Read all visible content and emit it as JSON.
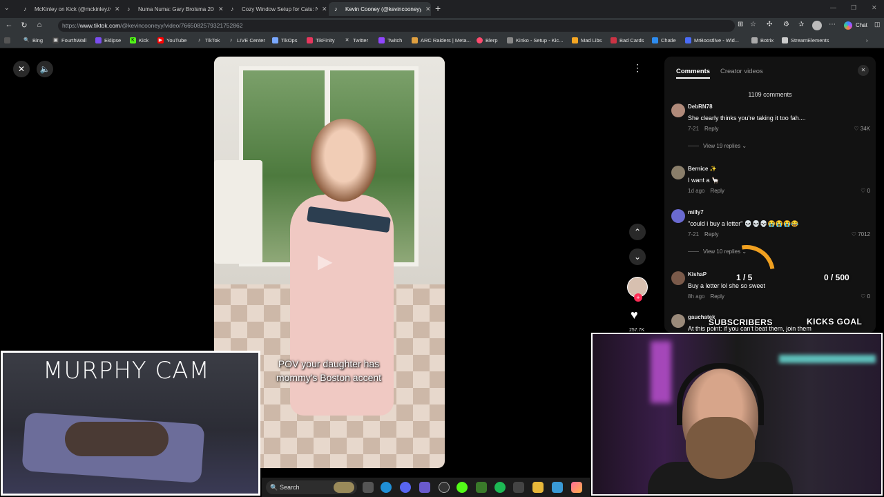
{
  "browser": {
    "tabs": [
      {
        "title": "McKinley on Kick (@mckinley.tv) |",
        "active": false
      },
      {
        "title": "Numa Numa: Gary Brolsma 2004 \\",
        "active": false
      },
      {
        "title": "Cozy Window Setup for Cats: Nic",
        "active": false
      },
      {
        "title": "Kevin Cooney (@kevincooneyy) |",
        "active": true
      }
    ],
    "new_tab": "+",
    "url_prefix": "https://",
    "url_host": "www.tiktok.com",
    "url_path": "/@kevincooneyy/video/7665082579321752862",
    "chat_label": "Chat",
    "bookmarks": [
      {
        "label": "Bing",
        "icon": "bing-icon",
        "color": "#2f7ee6"
      },
      {
        "label": "FourthWall",
        "icon": "fourthwall-icon",
        "color": "#444444"
      },
      {
        "label": "Eklipse",
        "icon": "eklipse-icon",
        "color": "#7b4df0"
      },
      {
        "label": "Kick",
        "icon": "kick-icon",
        "color": "#53fc18"
      },
      {
        "label": "YouTube",
        "icon": "youtube-icon",
        "color": "#ff0000"
      },
      {
        "label": "TikTok",
        "icon": "tiktok-icon",
        "color": "#111111"
      },
      {
        "label": "LIVE Center",
        "icon": "tiktok-icon",
        "color": "#111111"
      },
      {
        "label": "TikOps",
        "icon": "tikops-icon",
        "color": "#7aa8ff"
      },
      {
        "label": "TikFinity",
        "icon": "tikfinity-icon",
        "color": "#e8365d"
      },
      {
        "label": "Twitter",
        "icon": "x-icon",
        "color": "#111111"
      },
      {
        "label": "Twitch",
        "icon": "twitch-icon",
        "color": "#9146ff"
      },
      {
        "label": "ARC Raiders | Meta...",
        "icon": "arc-icon",
        "color": "#e0a040"
      },
      {
        "label": "Blerp",
        "icon": "blerp-icon",
        "color": "#ff4b6e"
      },
      {
        "label": "Kinko - Setup - Kic...",
        "icon": "kinko-icon",
        "color": "#cccccc"
      },
      {
        "label": "Mad Libs",
        "icon": "madlibs-icon",
        "color": "#f5a623"
      },
      {
        "label": "Bad Cards",
        "icon": "badcards-icon",
        "color": "#cc3344"
      },
      {
        "label": "Chatle",
        "icon": "chatle-icon",
        "color": "#2d8cf0"
      },
      {
        "label": "MrBoostlive - Wid...",
        "icon": "mrboost-icon",
        "color": "#4a6cf7"
      },
      {
        "label": "Botrix",
        "icon": "botrix-icon",
        "color": "#aaaaaa"
      },
      {
        "label": "StreamElements",
        "icon": "streamelements-icon",
        "color": "#cccccc"
      }
    ]
  },
  "video": {
    "caption": "POV your daughter has mommy's Boston accent",
    "likes_partial": "257.7K"
  },
  "comments_panel": {
    "tab_comments": "Comments",
    "tab_creator": "Creator videos",
    "count": "1109 comments",
    "reply_label": "Reply",
    "comments": [
      {
        "user": "DebRN78",
        "text": "She clearly thinks you're taking it too fah....",
        "date": "7-21",
        "likes": "34K",
        "replies": "View 19 replies",
        "avatar": "#b08a7a"
      },
      {
        "user": "Bernice ✨",
        "text": "I want a 🦙",
        "date": "1d ago",
        "likes": "0",
        "replies": "",
        "avatar": "#8a7e6a"
      },
      {
        "user": "milly7",
        "text": "\"could i buy a letter\" 💀💀💀😭😭😭😂",
        "date": "7-21",
        "likes": "7012",
        "replies": "View 10 replies",
        "avatar": "#6a6ad0"
      },
      {
        "user": "KishaP",
        "text": "Buy a letter lol she so sweet",
        "date": "8h ago",
        "likes": "0",
        "replies": "",
        "avatar": "#7a5a4a"
      },
      {
        "user": "gauchatek",
        "text": "At this point: if you can't beat them, join them",
        "date": "",
        "likes": "",
        "replies": "",
        "avatar": "#9a8a7a"
      }
    ]
  },
  "overlays": {
    "subs_count": "1 / 5",
    "subs_label": "SUBSCRIBERS",
    "kicks_count": "0 / 500",
    "kicks_label": "KICKS GOAL",
    "subs_progress": 0.2,
    "murphy_title": "MURPHY CAM"
  },
  "taskbar": {
    "search_placeholder": "Search"
  }
}
